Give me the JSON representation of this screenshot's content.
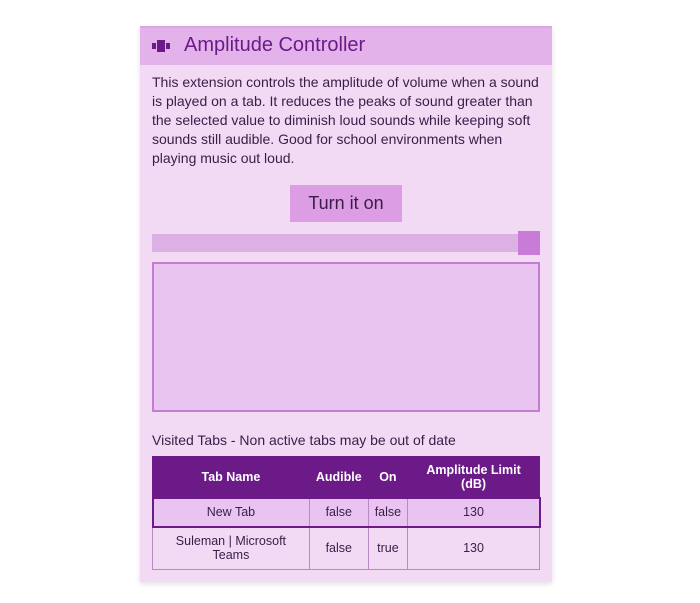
{
  "header": {
    "title": "Amplitude Controller",
    "icon": "volume-controller-icon"
  },
  "description": "This extension controls the amplitude of volume when a sound is played on a tab. It reduces the peaks of sound greater than the selected value to diminish loud sounds while keeping soft sounds still audible. Good for school environments when playing music out loud.",
  "toggle_button_label": "Turn it on",
  "slider": {
    "position_pct": 97
  },
  "visited_label": "Visited Tabs - Non active tabs may be out of date",
  "table": {
    "columns": [
      "Tab Name",
      "Audible",
      "On",
      "Amplitude Limit (dB)"
    ],
    "rows": [
      {
        "highlighted": true,
        "cells": [
          "New Tab",
          "false",
          "false",
          "130"
        ]
      },
      {
        "highlighted": false,
        "cells": [
          "Suleman | Microsoft Teams",
          "false",
          "true",
          "130"
        ]
      }
    ]
  }
}
